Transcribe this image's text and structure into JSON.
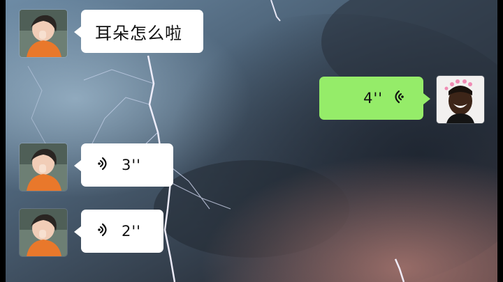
{
  "conversation": {
    "messages": [
      {
        "side": "left",
        "type": "text",
        "text": "耳朵怎么啦"
      },
      {
        "side": "right",
        "type": "voice",
        "duration": "4''"
      },
      {
        "side": "left",
        "type": "voice",
        "duration": "3''"
      },
      {
        "side": "left",
        "type": "voice",
        "duration": "2''"
      }
    ]
  },
  "colors": {
    "incoming_bubble": "#ffffff",
    "outgoing_bubble": "#95ec69",
    "background": "#3a4452"
  },
  "icons": {
    "voice": "voice-wave-icon"
  }
}
